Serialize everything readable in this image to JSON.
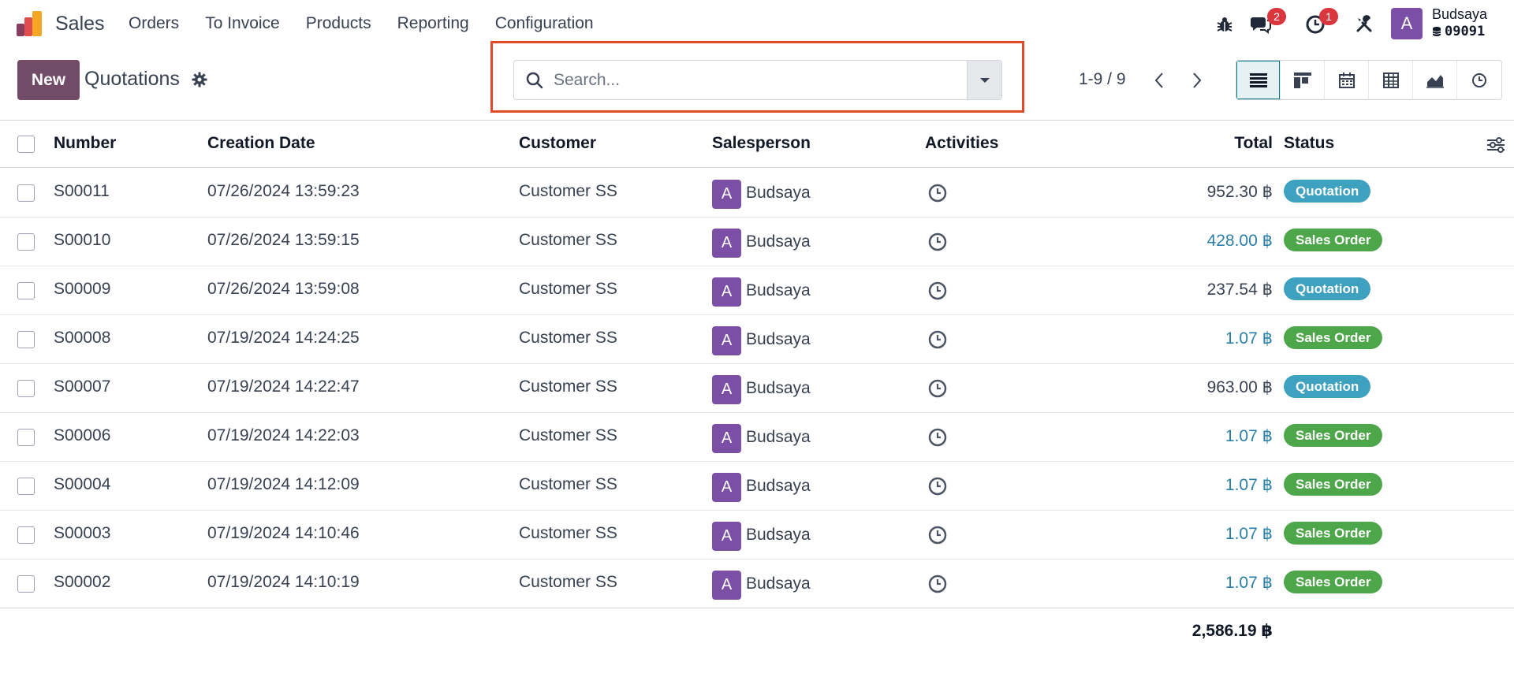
{
  "app": {
    "name": "Sales"
  },
  "nav": {
    "items": [
      {
        "label": "Orders"
      },
      {
        "label": "To Invoice"
      },
      {
        "label": "Products"
      },
      {
        "label": "Reporting"
      },
      {
        "label": "Configuration"
      }
    ]
  },
  "systray": {
    "messages_count": "2",
    "activities_count": "1",
    "user_initial": "A",
    "user_name": "Budsaya",
    "database": "09091"
  },
  "control_panel": {
    "new_label": "New",
    "title": "Quotations",
    "search_placeholder": "Search...",
    "pager": "1-9 / 9",
    "active_view": "list",
    "views": [
      "list-view",
      "kanban-view",
      "calendar-view",
      "pivot-view",
      "graph-view",
      "activity-view"
    ]
  },
  "table": {
    "columns": {
      "number": "Number",
      "creation_date": "Creation Date",
      "customer": "Customer",
      "salesperson": "Salesperson",
      "activities": "Activities",
      "total": "Total",
      "status": "Status"
    },
    "rows": [
      {
        "number": "S00011",
        "date": "07/26/2024 13:59:23",
        "customer": "Customer SS",
        "sp_initial": "A",
        "salesperson": "Budsaya",
        "total": "952.30 ฿",
        "status": "Quotation"
      },
      {
        "number": "S00010",
        "date": "07/26/2024 13:59:15",
        "customer": "Customer SS",
        "sp_initial": "A",
        "salesperson": "Budsaya",
        "total": "428.00 ฿",
        "status": "Sales Order"
      },
      {
        "number": "S00009",
        "date": "07/26/2024 13:59:08",
        "customer": "Customer SS",
        "sp_initial": "A",
        "salesperson": "Budsaya",
        "total": "237.54 ฿",
        "status": "Quotation"
      },
      {
        "number": "S00008",
        "date": "07/19/2024 14:24:25",
        "customer": "Customer SS",
        "sp_initial": "A",
        "salesperson": "Budsaya",
        "total": "1.07 ฿",
        "status": "Sales Order"
      },
      {
        "number": "S00007",
        "date": "07/19/2024 14:22:47",
        "customer": "Customer SS",
        "sp_initial": "A",
        "salesperson": "Budsaya",
        "total": "963.00 ฿",
        "status": "Quotation"
      },
      {
        "number": "S00006",
        "date": "07/19/2024 14:22:03",
        "customer": "Customer SS",
        "sp_initial": "A",
        "salesperson": "Budsaya",
        "total": "1.07 ฿",
        "status": "Sales Order"
      },
      {
        "number": "S00004",
        "date": "07/19/2024 14:12:09",
        "customer": "Customer SS",
        "sp_initial": "A",
        "salesperson": "Budsaya",
        "total": "1.07 ฿",
        "status": "Sales Order"
      },
      {
        "number": "S00003",
        "date": "07/19/2024 14:10:46",
        "customer": "Customer SS",
        "sp_initial": "A",
        "salesperson": "Budsaya",
        "total": "1.07 ฿",
        "status": "Sales Order"
      },
      {
        "number": "S00002",
        "date": "07/19/2024 14:10:19",
        "customer": "Customer SS",
        "sp_initial": "A",
        "salesperson": "Budsaya",
        "total": "1.07 ฿",
        "status": "Sales Order"
      }
    ],
    "grand_total": "2,586.19 ฿"
  },
  "colors": {
    "brand": "#714b67",
    "avatar": "#7b4fa6",
    "quotation_badge": "#3fa1c0",
    "sales_order_badge": "#4ea64a",
    "sales_order_total": "#2a7fa8",
    "default_total": "#374151",
    "highlight": "#e24a2c"
  }
}
